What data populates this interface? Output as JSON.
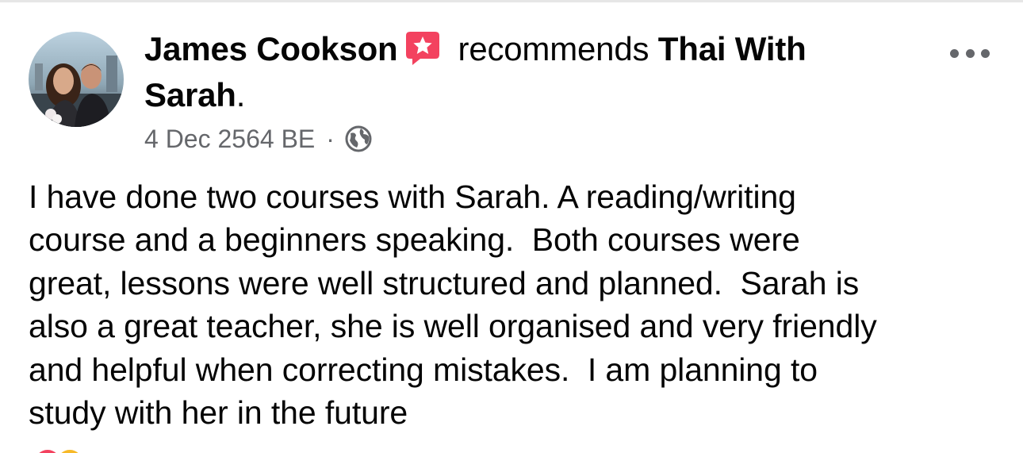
{
  "post": {
    "author": "James Cookson",
    "verb": "recommends",
    "page_name": "Thai With",
    "page_name_line2": "Sarah",
    "period": ".",
    "date": "4 Dec 2564 BE",
    "separator": "·",
    "audience_icon": "globe-icon",
    "recommend_icon": "recommendation-star-icon",
    "menu_icon": "more-options-icon",
    "body_lines": [
      "I have done two courses with Sarah. A reading/writing",
      "course and a beginners speaking.  Both courses were",
      "great, lessons were well structured and planned.  Sarah is",
      "also a great teacher, she is well organised and very friendly",
      "and helpful when correcting mistakes.  I am planning to",
      "study with her in the future"
    ]
  },
  "colors": {
    "text_primary": "#050505",
    "text_secondary": "#65676b",
    "recommend_accent": "#f3425f"
  }
}
